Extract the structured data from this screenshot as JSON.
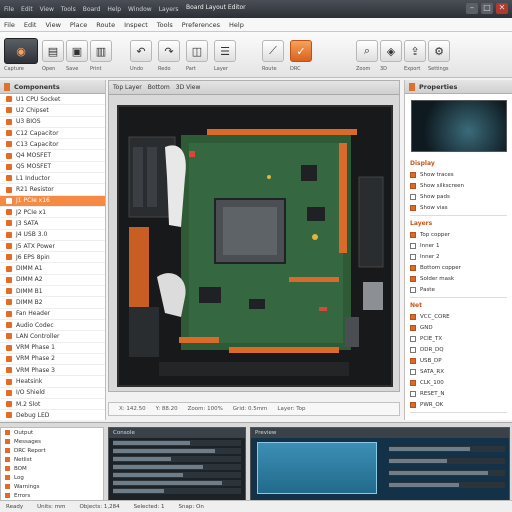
{
  "title_bar": {
    "menus": [
      "File",
      "Edit",
      "View",
      "Tools",
      "Board",
      "Help",
      "Window",
      "Layers"
    ],
    "title": "Board Layout Editor",
    "controls": [
      "–",
      "□",
      "✕"
    ]
  },
  "menu_bar": {
    "items": [
      "File",
      "Edit",
      "View",
      "Place",
      "Route",
      "Inspect",
      "Tools",
      "Preferences",
      "Help"
    ]
  },
  "toolbar": {
    "buttons": [
      {
        "icon": "camera-icon",
        "label": "Capture"
      },
      {
        "icon": "open-icon",
        "label": "Open"
      },
      {
        "icon": "save-icon",
        "label": "Save"
      },
      {
        "icon": "print-icon",
        "label": "Print"
      },
      {
        "icon": "undo-icon",
        "label": "Undo"
      },
      {
        "icon": "redo-icon",
        "label": "Redo"
      },
      {
        "icon": "component-icon",
        "label": "Part"
      },
      {
        "icon": "layer-icon",
        "label": "Layer"
      },
      {
        "icon": "route-icon",
        "label": "Route"
      },
      {
        "icon": "drc-icon",
        "label": "DRC"
      },
      {
        "icon": "zoom-icon",
        "label": "Zoom"
      },
      {
        "icon": "3d-icon",
        "label": "3D"
      },
      {
        "icon": "export-icon",
        "label": "Export"
      },
      {
        "icon": "settings-icon",
        "label": "Settings"
      }
    ]
  },
  "left_panel": {
    "title": "Components",
    "items": [
      "U1 CPU Socket",
      "U2 Chipset",
      "U3 BIOS",
      "C12 Capacitor",
      "C13 Capacitor",
      "Q4 MOSFET",
      "Q5 MOSFET",
      "L1 Inductor",
      "R21 Resistor",
      "J1 PCIe x16",
      "J2 PCIe x1",
      "J3 SATA",
      "J4 USB 3.0",
      "J5 ATX Power",
      "J6 EPS 8pin",
      "DIMM A1",
      "DIMM A2",
      "DIMM B1",
      "DIMM B2",
      "Fan Header",
      "Audio Codec",
      "LAN Controller",
      "VRM Phase 1",
      "VRM Phase 2",
      "VRM Phase 3",
      "Heatsink",
      "I/O Shield",
      "M.2 Slot",
      "Debug LED"
    ],
    "selected_index": 9
  },
  "viewport": {
    "tabs": [
      "Top Layer",
      "Bottom",
      "3D View"
    ],
    "status": [
      "X: 142.50",
      "Y: 88.20",
      "Zoom: 100%",
      "Grid: 0.5mm",
      "Layer: Top"
    ]
  },
  "right_panel": {
    "title": "Properties",
    "sections": [
      {
        "heading": "Display",
        "rows": [
          {
            "label": "Show traces",
            "on": true
          },
          {
            "label": "Show silkscreen",
            "on": true
          },
          {
            "label": "Show pads",
            "on": false
          },
          {
            "label": "Show vias",
            "on": true
          }
        ]
      },
      {
        "heading": "Layers",
        "rows": [
          {
            "label": "Top copper",
            "on": true
          },
          {
            "label": "Inner 1",
            "on": false
          },
          {
            "label": "Inner 2",
            "on": false
          },
          {
            "label": "Bottom copper",
            "on": true
          },
          {
            "label": "Solder mask",
            "on": true
          },
          {
            "label": "Paste",
            "on": false
          }
        ]
      },
      {
        "heading": "Net",
        "rows": [
          {
            "label": "VCC_CORE",
            "on": true
          },
          {
            "label": "GND",
            "on": true
          },
          {
            "label": "PCIE_TX",
            "on": false
          },
          {
            "label": "DDR_DQ",
            "on": false
          },
          {
            "label": "USB_DP",
            "on": true
          },
          {
            "label": "SATA_RX",
            "on": false
          },
          {
            "label": "CLK_100",
            "on": true
          },
          {
            "label": "RESET_N",
            "on": false
          },
          {
            "label": "PWR_OK",
            "on": true
          }
        ]
      }
    ]
  },
  "bottom": {
    "left_rows": [
      "Output",
      "Messages",
      "DRC Report",
      "Netlist",
      "BOM",
      "Log",
      "Warnings",
      "Errors"
    ],
    "panel_a_title": "Console",
    "panel_b_title": "Preview"
  },
  "status_bar": [
    "Ready",
    "Units: mm",
    "Objects: 1,284",
    "Selected: 1",
    "Snap: On"
  ]
}
